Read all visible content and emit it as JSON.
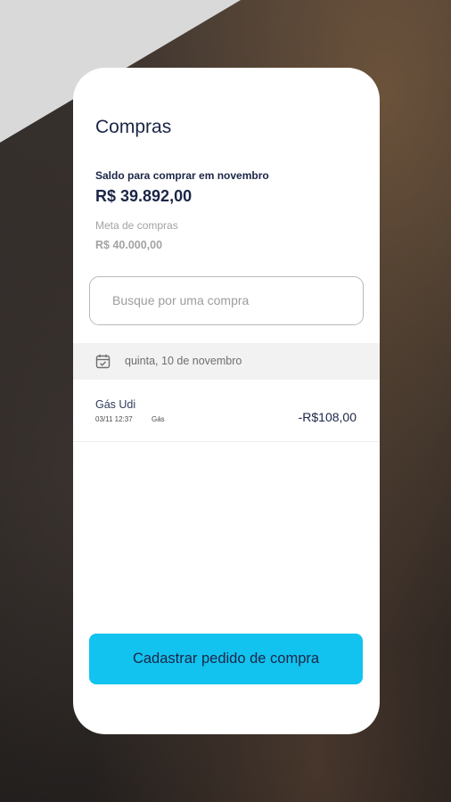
{
  "colors": {
    "accent": "#12c3ef",
    "text_primary": "#1b2547",
    "muted": "#a3a3a3",
    "card_bg": "#ffffff"
  },
  "page": {
    "title": "Compras"
  },
  "balance": {
    "label": "Saldo para comprar em novembro",
    "value": "R$ 39.892,00"
  },
  "goal": {
    "label": "Meta de compras",
    "value": "R$ 40.000,00"
  },
  "search": {
    "placeholder": "Busque por uma compra",
    "value": ""
  },
  "date_group": {
    "icon": "calendar-icon",
    "label": "quinta, 10 de novembro"
  },
  "transactions": [
    {
      "name": "Gás Udi",
      "datetime": "03/11 12:37",
      "category": "Gás",
      "amount": "-R$108,00"
    }
  ],
  "actions": {
    "register_label": "Cadastrar pedido de compra"
  }
}
